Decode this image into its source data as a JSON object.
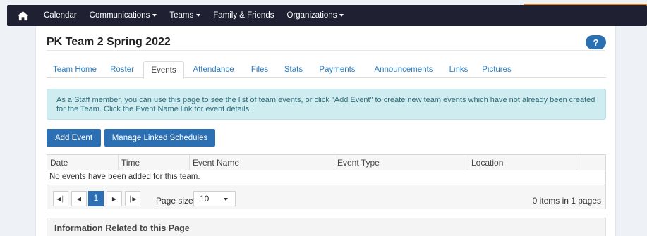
{
  "nav": {
    "items": [
      {
        "label": "Calendar",
        "dropdown": false
      },
      {
        "label": "Communications",
        "dropdown": true
      },
      {
        "label": "Teams",
        "dropdown": true
      },
      {
        "label": "Family & Friends",
        "dropdown": false
      },
      {
        "label": "Organizations",
        "dropdown": true
      }
    ],
    "home_icon": "home-icon",
    "bar_color": "#1f2133"
  },
  "page": {
    "title": "PK Team 2 Spring 2022",
    "help_label": "?"
  },
  "tabs": [
    {
      "label": "Team Home"
    },
    {
      "label": "Roster"
    },
    {
      "label": "Events",
      "active": true
    },
    {
      "label": "Attendance"
    },
    {
      "label": "Files"
    },
    {
      "label": "Stats"
    },
    {
      "label": "Payments"
    },
    {
      "label": "Announcements"
    },
    {
      "label": "Links"
    },
    {
      "label": "Pictures"
    }
  ],
  "alert": {
    "text": "As a Staff member, you can use this page to see the list of team events, or click \"Add Event\" to create new team events which have not already been created for the Team. Click the Event Name link for event details."
  },
  "actions": {
    "add_event": "Add Event",
    "manage_linked": "Manage Linked Schedules"
  },
  "grid": {
    "columns": [
      "Date",
      "Time",
      "Event Name",
      "Event Type",
      "Location"
    ],
    "empty_message": "No events have been added for this team.",
    "pager": {
      "current_page": "1",
      "page_size_label": "Page size:",
      "page_size": "10",
      "info": "0 items in 1 pages"
    }
  },
  "related": {
    "title": "Information Related to this Page"
  },
  "colors": {
    "primary": "#2c70b3",
    "link": "#2b7ec1",
    "alert_bg": "#cfecf0"
  }
}
